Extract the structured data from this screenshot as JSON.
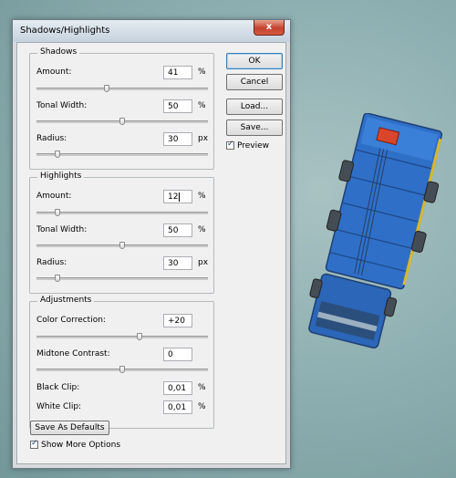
{
  "dialog": {
    "title": "Shadows/Highlights",
    "close_label": "x"
  },
  "shadows": {
    "title": "Shadows",
    "amount": {
      "label": "Amount:",
      "value": "41",
      "unit": "%",
      "level": 0.41
    },
    "tonal_width": {
      "label": "Tonal Width:",
      "value": "50",
      "unit": "%",
      "level": 0.5
    },
    "radius": {
      "label": "Radius:",
      "value": "30",
      "unit": "px",
      "level": 0.12
    }
  },
  "highlights": {
    "title": "Highlights",
    "amount": {
      "label": "Amount:",
      "value": "12",
      "unit": "%",
      "level": 0.12
    },
    "tonal_width": {
      "label": "Tonal Width:",
      "value": "50",
      "unit": "%",
      "level": 0.5
    },
    "radius": {
      "label": "Radius:",
      "value": "30",
      "unit": "px",
      "level": 0.12
    }
  },
  "adjustments": {
    "title": "Adjustments",
    "color_correction": {
      "label": "Color Correction:",
      "value": "+20",
      "level": 0.6
    },
    "midtone_contrast": {
      "label": "Midtone Contrast:",
      "value": "0",
      "level": 0.5
    },
    "black_clip": {
      "label": "Black Clip:",
      "value": "0,01",
      "unit": "%"
    },
    "white_clip": {
      "label": "White Clip:",
      "value": "0,01",
      "unit": "%"
    }
  },
  "buttons": {
    "ok": "OK",
    "cancel": "Cancel",
    "load": "Load...",
    "save": "Save...",
    "save_defaults": "Save As Defaults"
  },
  "checkboxes": {
    "preview": {
      "label": "Preview",
      "checked": true
    },
    "more_options": {
      "label": "Show More Options",
      "checked": true
    }
  },
  "colors": {
    "truck_blue": "#2f6fc7",
    "close_red": "#c5432e"
  }
}
